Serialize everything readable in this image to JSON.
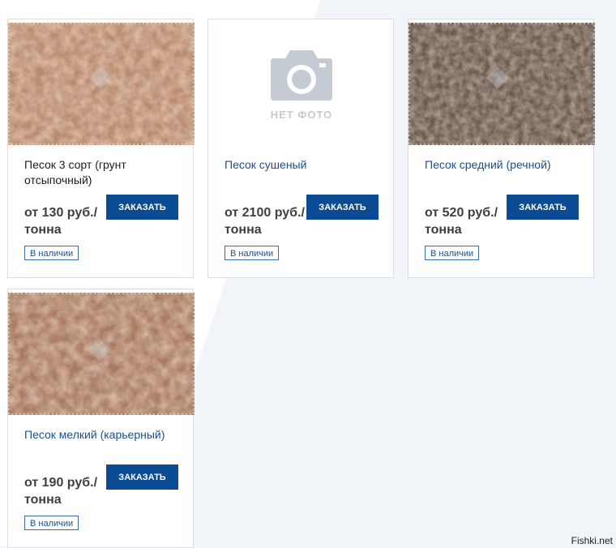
{
  "products": [
    {
      "title": "Песок 3 сорт (грунт отсыпочный)",
      "price": "от 130 руб./тонна",
      "order_label": "ЗАКАЗАТЬ",
      "stock_label": "В наличии",
      "image": "sand-photo-light"
    },
    {
      "title": "Песок сушеный",
      "price": "от 2100 руб./тонна",
      "order_label": "ЗАКАЗАТЬ",
      "stock_label": "В наличии",
      "image": "no-photo-placeholder",
      "no_photo_label": "НЕТ ФОТО"
    },
    {
      "title": "Песок средний (речной)",
      "price": "от 520 руб./тонна",
      "order_label": "ЗАКАЗАТЬ",
      "stock_label": "В наличии",
      "image": "soil-photo-dark"
    },
    {
      "title": "Песок мелкий (карьерный)",
      "price": "от 190 руб./тонна",
      "order_label": "ЗАКАЗАТЬ",
      "stock_label": "В наличии",
      "image": "sand-photo-medium"
    }
  ],
  "watermark": "Fishki.net",
  "colors": {
    "button": "#0b4b93",
    "link": "#1a4f8c",
    "background": "#f1f4f8"
  }
}
